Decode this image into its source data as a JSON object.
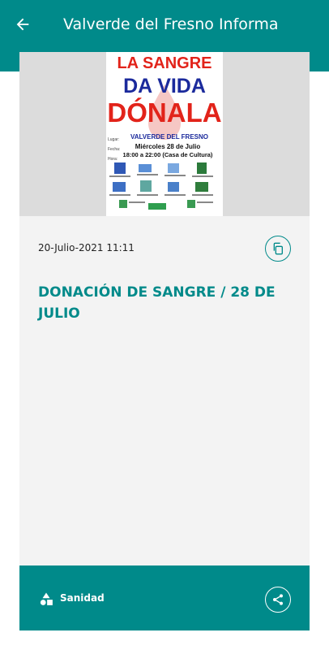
{
  "header": {
    "title": "Valverde del Fresno Informa"
  },
  "post": {
    "date": "20-Julio-2021 11:11",
    "title": "DONACIÓN DE SANGRE / 28 DE JULIO",
    "category": "Sanidad"
  },
  "poster": {
    "line1": "LA SANGRE",
    "line2": "DA VIDA",
    "line3": "DÓNALA",
    "town": "VALVERDE DEL FRESNO",
    "place_label": "Lugar:",
    "date_label": "Fecha:",
    "time_label": "Hora:",
    "date": "Miércoles 28 de Julio",
    "time": "18:00 a 22:00 (Casa de Cultura)"
  },
  "colors": {
    "primary": "#008a8a",
    "poster_red": "#e2231a",
    "poster_blue": "#1b2a9c"
  }
}
